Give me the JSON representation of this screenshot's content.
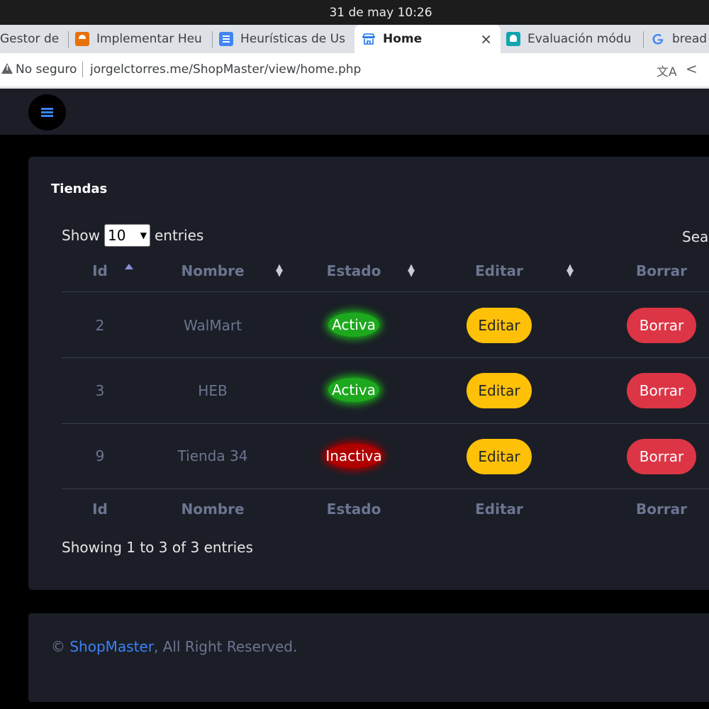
{
  "os": {
    "datetime": "31 de may  10:26"
  },
  "tabs": [
    {
      "title": "Gestor de",
      "icon": ""
    },
    {
      "title": "Implementar Heu",
      "icon": "orange-doc-icon"
    },
    {
      "title": "Heurísticas de Us",
      "icon": "google-docs-icon"
    },
    {
      "title": "Home",
      "icon": "store-icon",
      "active": true,
      "close": "×"
    },
    {
      "title": "Evaluación módu",
      "icon": "classroom-icon"
    },
    {
      "title": "bread",
      "icon": "google-icon"
    }
  ],
  "address": {
    "security": "No seguro",
    "url": "jorgelctorres.me/ShopMaster/view/home.php"
  },
  "card": {
    "title": "Tiendas",
    "show_label": "Show",
    "entries_label": "entries",
    "page_length": "10",
    "search_label": "Search:"
  },
  "table": {
    "headers": [
      "Id",
      "Nombre",
      "Estado",
      "Editar",
      "Borrar"
    ],
    "rows": [
      {
        "id": "2",
        "nombre": "WalMart",
        "estado": "Activa",
        "editar": "Editar",
        "borrar": "Borrar"
      },
      {
        "id": "3",
        "nombre": "HEB",
        "estado": "Activa",
        "editar": "Editar",
        "borrar": "Borrar"
      },
      {
        "id": "9",
        "nombre": "Tienda 34",
        "estado": "Inactiva",
        "editar": "Editar",
        "borrar": "Borrar"
      }
    ],
    "info": "Showing 1 to 3 of 3 entries"
  },
  "footer": {
    "copyright": "©",
    "brand": "ShopMaster",
    "rest": ", All Right Reserved."
  },
  "colors": {
    "accent": "#3b82f6",
    "active": "#1ea81e",
    "inactive": "#b00000",
    "edit": "#ffc107",
    "delete": "#dc3545",
    "panel": "#1b1e27"
  }
}
